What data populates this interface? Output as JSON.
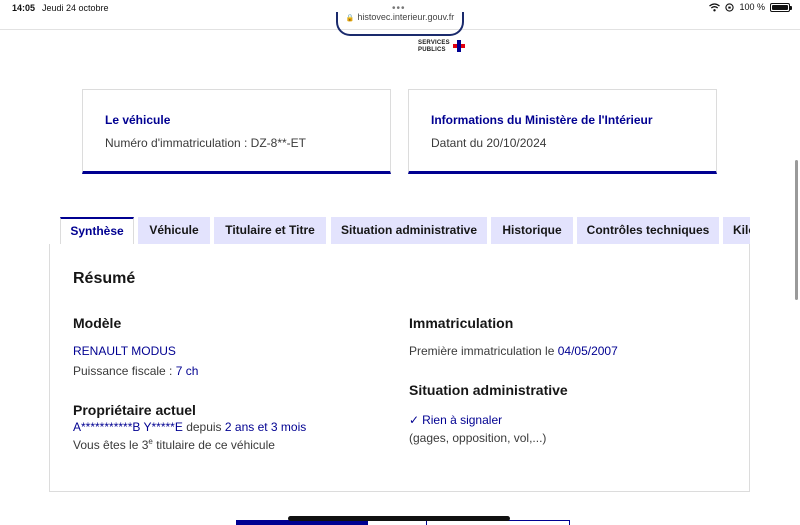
{
  "status_bar": {
    "time": "14:05",
    "date": "Jeudi 24 octobre",
    "battery": "100 %"
  },
  "browser": {
    "url": "histovec.interieur.gouv.fr"
  },
  "header": {
    "services_line1": "SERVICES",
    "services_line2": "PUBLICS"
  },
  "cards": [
    {
      "title": "Le véhicule",
      "text": "Numéro d'immatriculation : DZ-8**-ET"
    },
    {
      "title": "Informations du Ministère de l'Intérieur",
      "text": "Datant du 20/10/2024"
    }
  ],
  "tabs": [
    "Synthèse",
    "Véhicule",
    "Titulaire et Titre",
    "Situation administrative",
    "Historique",
    "Contrôles techniques",
    "Kilo"
  ],
  "summary": {
    "title": "Résumé",
    "model": {
      "heading": "Modèle",
      "name": "RENAULT MODUS",
      "fiscal_label": "Puissance fiscale : ",
      "fiscal_value": "7 ch"
    },
    "owner": {
      "heading": "Propriétaire actuel",
      "name": "A***********B Y*****E",
      "since_label": " depuis ",
      "since_value": "2 ans et 3 mois",
      "rank_prefix": "Vous êtes le ",
      "rank_num": "3",
      "rank_sup": "e",
      "rank_suffix": " titulaire de ce véhicule"
    },
    "registration": {
      "heading": "Immatriculation",
      "first_label": "Première immatriculation le ",
      "first_date": "04/05/2007"
    },
    "admin": {
      "heading": "Situation administrative",
      "status": "Rien à signaler",
      "detail": "(gages, opposition, vol,...)"
    }
  },
  "colors": {
    "primary": "#000091",
    "tab_bg": "#e3e3fd",
    "text": "#3a3a3a"
  }
}
